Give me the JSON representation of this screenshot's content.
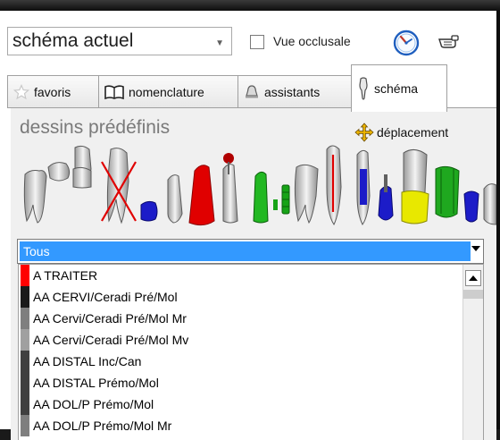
{
  "header": {
    "schema_select": "schéma actuel",
    "occlusal_view": {
      "label": "Vue occlusale",
      "checked": false
    }
  },
  "tabs": [
    {
      "label": "favoris",
      "icon": "star-icon",
      "active": false
    },
    {
      "label": "nomenclature",
      "icon": "open-book-icon",
      "active": false
    },
    {
      "label": "assistants",
      "icon": "bell-icon",
      "active": false
    },
    {
      "label": "schéma",
      "icon": "tooth-icon",
      "active": true
    }
  ],
  "content": {
    "title": "dessins prédéfinis",
    "move_label": "déplacement",
    "filter_value": "Tous",
    "items": [
      {
        "label": "A TRAITER",
        "color": "#ff0000"
      },
      {
        "label": "AA CERVI/Ceradi Pré/Mol",
        "color": "#1a1a1a"
      },
      {
        "label": "AA Cervi/Ceradi Pré/Mol Mr",
        "color": "#7f7f7f"
      },
      {
        "label": "AA Cervi/Ceradi Pré/Mol Mv",
        "color": "#a0a0a0"
      },
      {
        "label": "AA DISTAL Inc/Can",
        "color": "#404040"
      },
      {
        "label": "AA DISTAL Prémo/Mol",
        "color": "#404040"
      },
      {
        "label": "AA DOL/P Prémo/Mol",
        "color": "#404040"
      },
      {
        "label": "AA DOL/P Prémo/Mol Mr",
        "color": "#7f7f7f"
      }
    ]
  },
  "colors": {
    "selection": "#3399ff",
    "panel_bg": "#f0f0f0"
  }
}
